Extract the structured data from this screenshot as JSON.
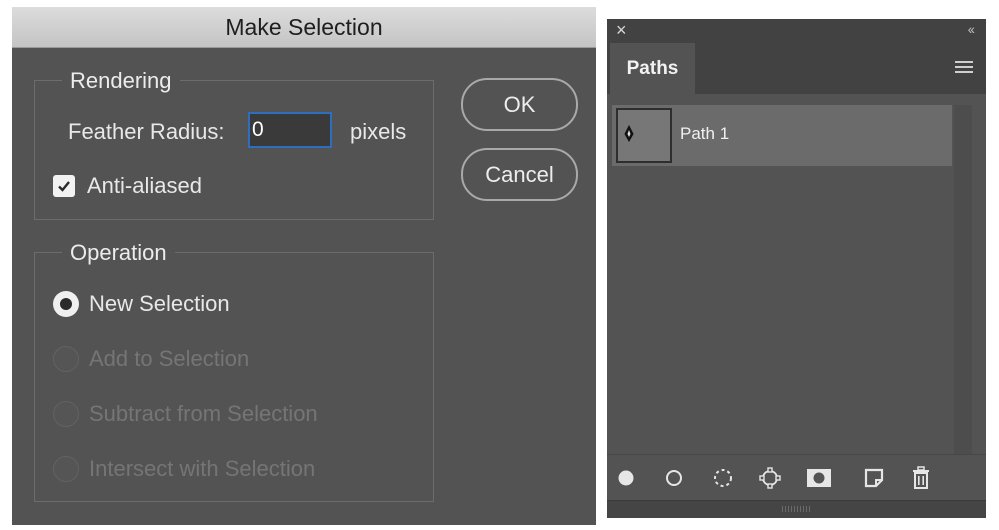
{
  "dialog": {
    "title": "Make Selection",
    "rendering": {
      "legend": "Rendering",
      "feather_label": "Feather Radius:",
      "feather_value": "0",
      "feather_unit": "pixels",
      "anti_aliased_label": "Anti-aliased",
      "anti_aliased_checked": true
    },
    "operation": {
      "legend": "Operation",
      "options": [
        {
          "label": "New Selection",
          "selected": true,
          "enabled": true
        },
        {
          "label": "Add to Selection",
          "selected": false,
          "enabled": false
        },
        {
          "label": "Subtract from Selection",
          "selected": false,
          "enabled": false
        },
        {
          "label": "Intersect with Selection",
          "selected": false,
          "enabled": false
        }
      ]
    },
    "ok_label": "OK",
    "cancel_label": "Cancel"
  },
  "panel": {
    "close_glyph": "×",
    "collapse_glyph": "‹‹",
    "tab_label": "Paths",
    "paths": [
      {
        "name": "Path 1"
      }
    ],
    "tools": [
      "fill-path-icon",
      "stroke-path-icon",
      "load-as-selection-icon",
      "make-work-path-icon",
      "add-mask-icon",
      "create-new-path-icon",
      "delete-path-icon"
    ]
  },
  "colors": {
    "dialog_bg": "#535353",
    "input_focus": "#2d6ebf",
    "title_bar": "#d0d0d0"
  }
}
